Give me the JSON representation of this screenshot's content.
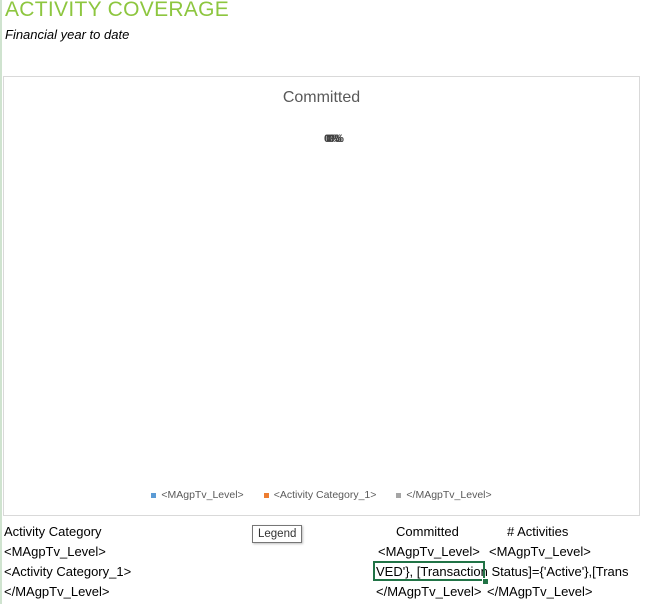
{
  "report": {
    "title": "ACTIVITY COVERAGE",
    "subtitle": "Financial year to date"
  },
  "chart_data": {
    "type": "pie",
    "title": "Committed",
    "slice_labels": [
      "0%",
      "0%",
      "0%"
    ],
    "legend": [
      {
        "name": "<MAgpTv_Level>",
        "color": "#5b9bd5"
      },
      {
        "name": "<Activity Category_1>",
        "color": "#ed7d31"
      },
      {
        "name": "</MAgpTv_Level>",
        "color": "#a5a5a5"
      }
    ],
    "values": [
      0,
      0,
      0
    ],
    "legend_position": "bottom"
  },
  "tooltip": "Legend",
  "table": {
    "headers": {
      "category": "Activity Category",
      "committed": "Committed",
      "activities": "# Activities"
    },
    "rows": [
      {
        "category": "<MAgpTv_Level>",
        "committed": "<MAgpTv_Level>",
        "activities": "<MAgpTv_Level>"
      },
      {
        "category": "<Activity Category_1>",
        "committed": "VED'}, [Transaction Status]={'Active'},[Trans",
        "activities": ""
      },
      {
        "category": "</MAgpTv_Level>",
        "committed": "</MAgpTv_Level>",
        "activities": "</MAgpTv_Level>"
      }
    ]
  }
}
